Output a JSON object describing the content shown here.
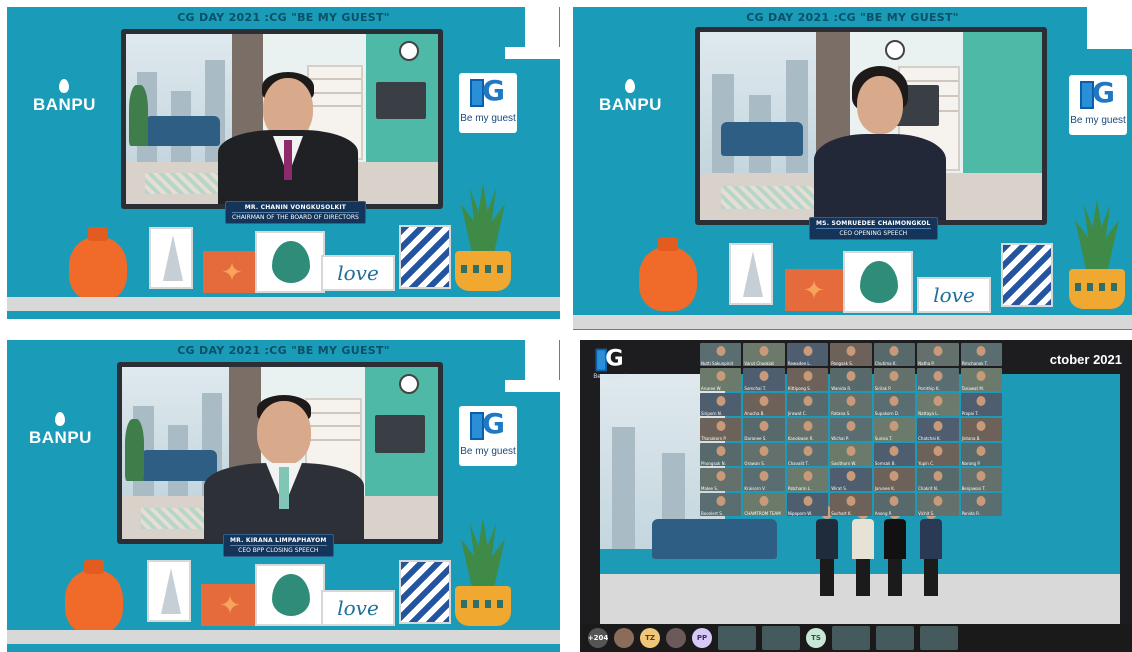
{
  "event_title": "CG DAY 2021 :CG \"BE MY GUEST\"",
  "brand": "BANPU",
  "be_my_guest_caption": "Be my guest",
  "panels": [
    {
      "name": "MR. CHANIN VONGKUSOLKIT",
      "role": "CHAIRMAN OF THE BOARD OF DIRECTORS"
    },
    {
      "name": "MS. SOMRUEDEE CHAIMONGKOL",
      "role": "CEO OPENING SPEECH"
    },
    {
      "name": "MR. KIRANA LIMPAPHAYOM",
      "role": "CEO BPP CLOSING SPEECH"
    }
  ],
  "deco_word": "love",
  "zoom": {
    "date_fragment": "ctober 2021",
    "participant_count": "+204",
    "avatar_initials": [
      "TZ",
      "PP",
      "TS"
    ],
    "tile_names": [
      "Nutti Sakunpinit",
      "Varut Chookiat",
      "Rewadee L.",
      "Pongsak S.",
      "Chutima K.",
      "Natha P.",
      "Pimchanok T.",
      "Arunee W.",
      "Somchai T.",
      "Kittipong S.",
      "Wanida R.",
      "Sirilak P.",
      "Pornthip K.",
      "Tanawat M.",
      "Siriporn N.",
      "Anucha B.",
      "Jirawat C.",
      "Ratana S.",
      "Supakorn D.",
      "Nattaya L.",
      "Prapai T.",
      "Thanakorn P.",
      "Daranee S.",
      "Kanokwan R.",
      "Wichai P.",
      "Sunisa T.",
      "Chatchai K.",
      "Jintana B.",
      "Phongsak N.",
      "Orawan S.",
      "Chavalit T.",
      "Sasithorn W.",
      "Somsak B.",
      "Yupin C.",
      "Narong P.",
      "Malee S.",
      "Kraisorn V.",
      "Patcharin L.",
      "Wirat S.",
      "Jarunee K.",
      "Chakrit N.",
      "Benjawan T.",
      "Boonlert S.",
      "CHAMTROM TEAM",
      "Nipaporn W.",
      "Suchart K.",
      "Anong P.",
      "Vichit S.",
      "Panida R."
    ]
  },
  "colors": {
    "wall": "#1a9bb8",
    "caption": "#14345a",
    "accent_orange": "#f06a2a"
  }
}
